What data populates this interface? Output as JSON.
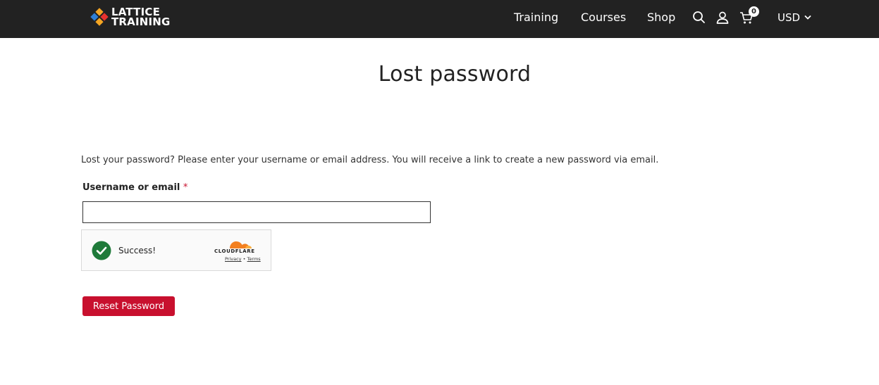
{
  "header": {
    "logo_line1": "LATTICE",
    "logo_line2": "TRAINING",
    "nav": {
      "training": "Training",
      "courses": "Courses",
      "shop": "Shop"
    },
    "cart_count": "0",
    "currency": "USD",
    "icons": [
      "search-icon",
      "user-icon",
      "cart-icon",
      "chevron-down-icon"
    ]
  },
  "main": {
    "title": "Lost password",
    "intro": "Lost your password? Please enter your username or email address. You will receive a link to create a new password via email.",
    "field_label": "Username or email",
    "required_mark": "*",
    "input_value": "",
    "captcha": {
      "status": "Success!",
      "brand": "CLOUDFLARE",
      "privacy": "Privacy",
      "separator": "•",
      "terms": "Terms"
    },
    "submit_label": "Reset Password"
  },
  "colors": {
    "header_bg": "#222222",
    "accent": "#c8102e",
    "success": "#1f7a3a",
    "cloudflare_orange": "#f38020"
  }
}
